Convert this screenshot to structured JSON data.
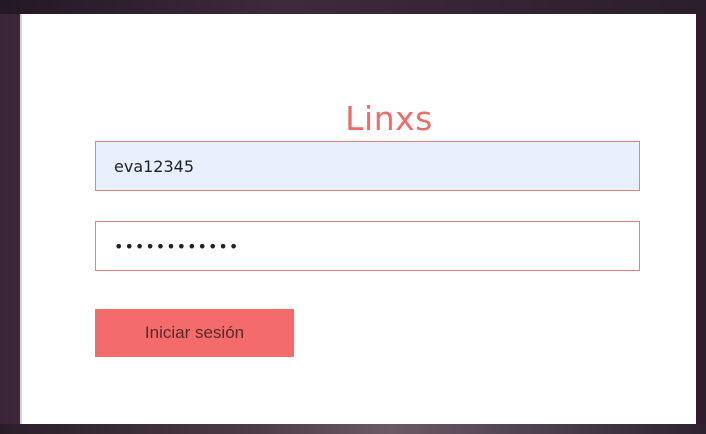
{
  "login": {
    "brand_title": "Linxs",
    "username_value": "eva12345",
    "password_value": "••••••••••••",
    "submit_label": "Iniciar sesión"
  },
  "theme": {
    "accent": "#f36b6b",
    "title_color": "#ef6c6a",
    "autofill_bg": "#e8f0fe",
    "border": "#ea7f7d"
  }
}
